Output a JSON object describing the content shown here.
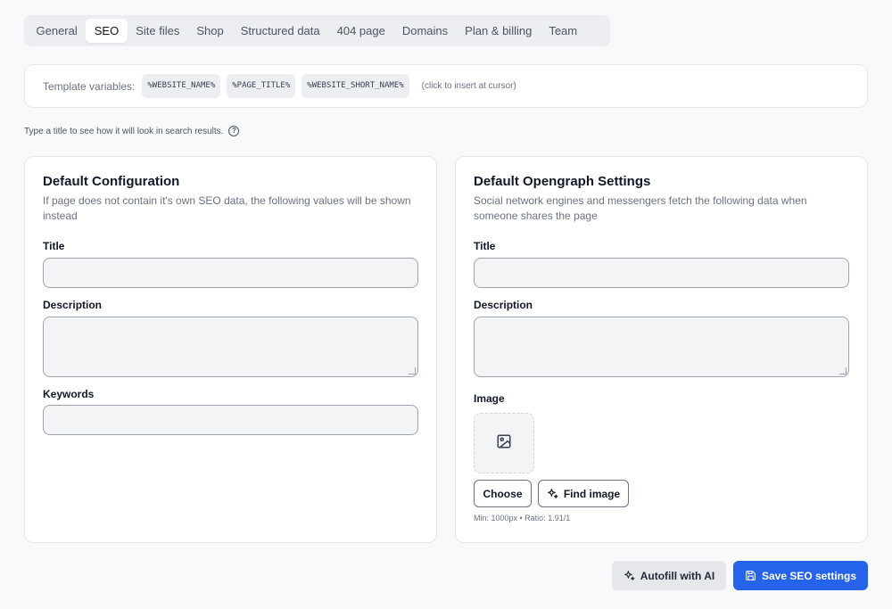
{
  "tabs": [
    {
      "label": "General"
    },
    {
      "label": "SEO",
      "active": true
    },
    {
      "label": "Site files"
    },
    {
      "label": "Shop"
    },
    {
      "label": "Structured data"
    },
    {
      "label": "404 page"
    },
    {
      "label": "Domains"
    },
    {
      "label": "Plan & billing"
    },
    {
      "label": "Team"
    }
  ],
  "template_vars": {
    "label": "Template variables:",
    "chips": [
      "%WEBSITE_NAME%",
      "%PAGE_TITLE%",
      "%WEBSITE_SHORT_NAME%"
    ],
    "hint": "(click to insert at cursor)"
  },
  "search_hint": "Type a title to see how it will look in search results.",
  "default_config": {
    "title": "Default Configuration",
    "subtitle": "If page does not contain it's own SEO data, the following values will be shown instead",
    "fields": {
      "title_label": "Title",
      "title_value": "",
      "description_label": "Description",
      "description_value": "",
      "keywords_label": "Keywords",
      "keywords_value": ""
    }
  },
  "opengraph": {
    "title": "Default Opengraph Settings",
    "subtitle": "Social network engines and messengers fetch the following data when someone shares the page",
    "fields": {
      "title_label": "Title",
      "title_value": "",
      "description_label": "Description",
      "description_value": "",
      "image_label": "Image"
    },
    "choose_label": "Choose",
    "find_image_label": "Find image",
    "image_hint": "Min: 1000px • Ratio: 1.91/1"
  },
  "actions": {
    "autofill_label": "Autofill with AI",
    "save_label": "Save SEO settings"
  },
  "colors": {
    "primary": "#2563eb",
    "background": "#f8f9fb"
  }
}
